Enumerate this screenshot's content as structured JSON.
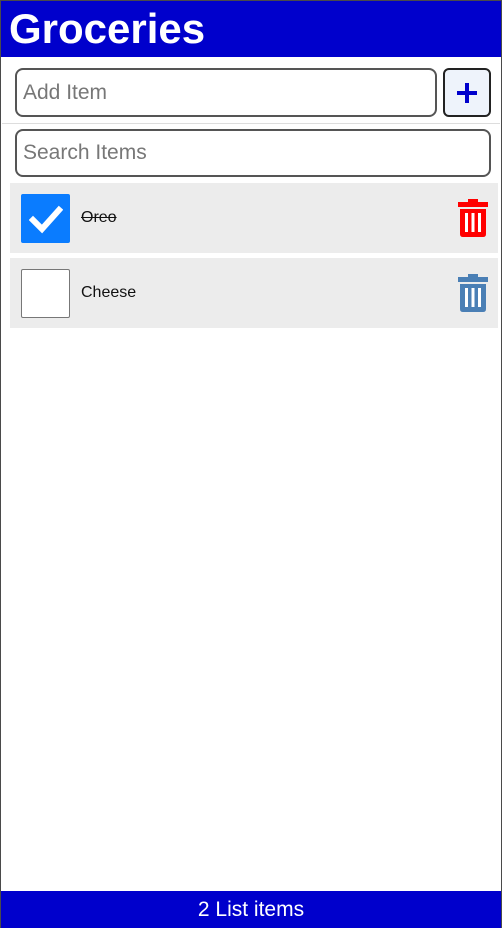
{
  "header": {
    "title": "Groceries"
  },
  "add_form": {
    "placeholder": "Add Item",
    "value": "",
    "button_icon": "plus-icon"
  },
  "search": {
    "placeholder": "Search Items",
    "value": ""
  },
  "items": [
    {
      "label": "Oreo",
      "checked": true,
      "delete_icon": "trash-icon"
    },
    {
      "label": "Cheese",
      "checked": false,
      "delete_icon": "trash-icon"
    }
  ],
  "footer": {
    "count_text": "2 List items"
  },
  "colors": {
    "brand": "#0000cc",
    "check_fill": "#0a7cff",
    "delete_checked": "#ff0000",
    "delete_unchecked": "#4a7fb5",
    "item_bg": "#ececec"
  }
}
